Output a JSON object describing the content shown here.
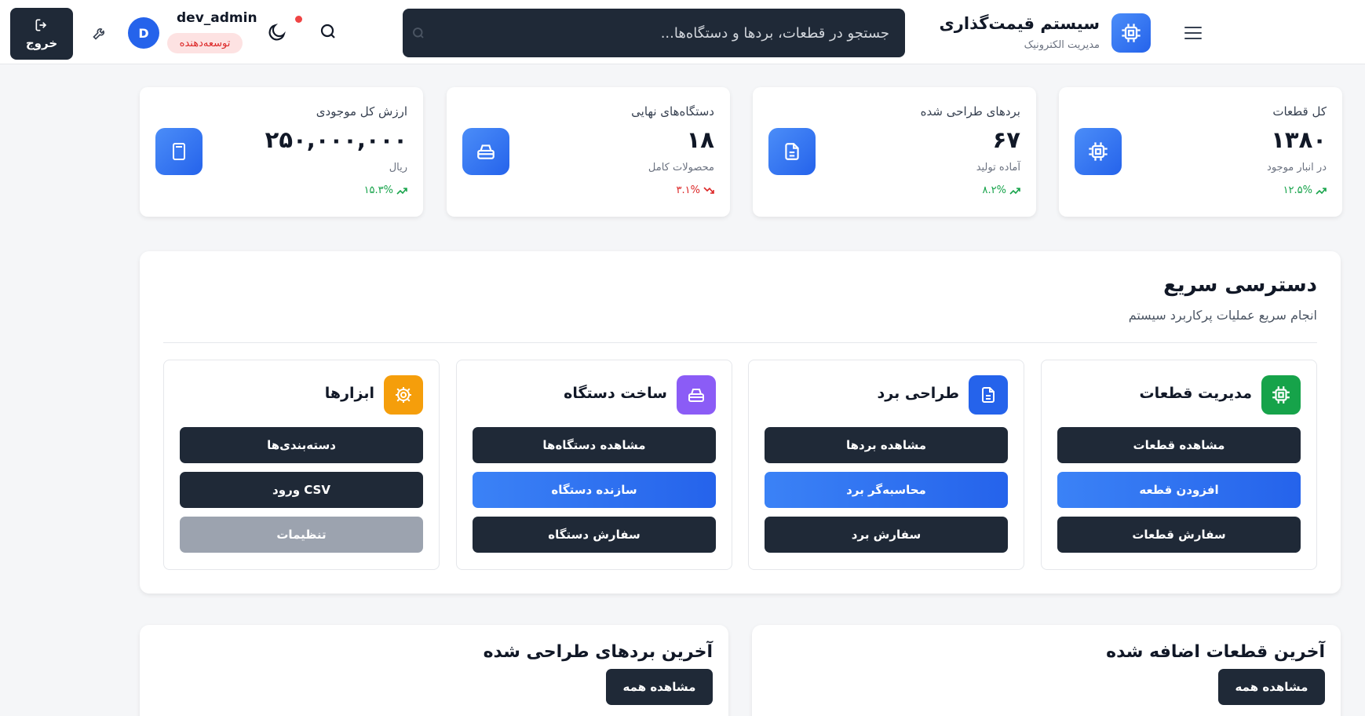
{
  "header": {
    "brand_title": "سیستم قیمت‌گذاری",
    "brand_subtitle": "مدیریت الکترونیک",
    "search_placeholder": "جستجو در قطعات، بردها و دستگاه‌ها...",
    "username": "dev_admin",
    "role": "توسعه‌دهنده",
    "avatar_letter": "D",
    "logout_label": "خروج"
  },
  "stats": [
    {
      "title": "کل قطعات",
      "value": "۱۳۸۰",
      "subtitle": "در انبار موجود",
      "change": "۱۲.۵%",
      "trend": "up",
      "icon": "chip-icon"
    },
    {
      "title": "بردهای طراحی شده",
      "value": "۶۷",
      "subtitle": "آماده تولید",
      "change": "۸.۲%",
      "trend": "up",
      "icon": "document-icon"
    },
    {
      "title": "دستگاه‌های نهایی",
      "value": "۱۸",
      "subtitle": "محصولات کامل",
      "change": "۳.۱%",
      "trend": "down",
      "icon": "device-icon"
    },
    {
      "title": "ارزش کل موجودی",
      "value": "۲۵۰,۰۰۰,۰۰۰",
      "subtitle": "ریال",
      "change": "۱۵.۳%",
      "trend": "up",
      "icon": "calculator-icon"
    }
  ],
  "quick_access": {
    "title": "دسترسی سریع",
    "subtitle": "انجام سریع عملیات پرکاربرد سیستم",
    "sections": [
      {
        "title": "مدیریت قطعات",
        "icon": "chip-icon",
        "color": "#16a34a",
        "buttons": [
          "مشاهده قطعات",
          "افزودن قطعه",
          "سفارش قطعات"
        ]
      },
      {
        "title": "طراحی برد",
        "icon": "document-icon",
        "color": "#2563eb",
        "buttons": [
          "مشاهده بردها",
          "محاسبه‌گر برد",
          "سفارش برد"
        ]
      },
      {
        "title": "ساخت دستگاه",
        "icon": "device-icon",
        "color": "#8b5cf6",
        "buttons": [
          "مشاهده دستگاه‌ها",
          "سازنده دستگاه",
          "سفارش دستگاه"
        ]
      },
      {
        "title": "ابزارها",
        "icon": "gear-icon",
        "color": "#f59e0b",
        "buttons": [
          "دسته‌بندی‌ها",
          "ورود CSV",
          "تنظیمات"
        ]
      }
    ]
  },
  "panels": {
    "recent_parts": {
      "title": "آخرین قطعات اضافه شده",
      "button": "مشاهده همه"
    },
    "recent_boards": {
      "title": "آخرین بردهای طراحی شده",
      "button": "مشاهده همه"
    }
  },
  "colors": {
    "accent": "#2563eb",
    "dark": "#1f2937",
    "up": "#16a34a",
    "down": "#dc2626"
  }
}
